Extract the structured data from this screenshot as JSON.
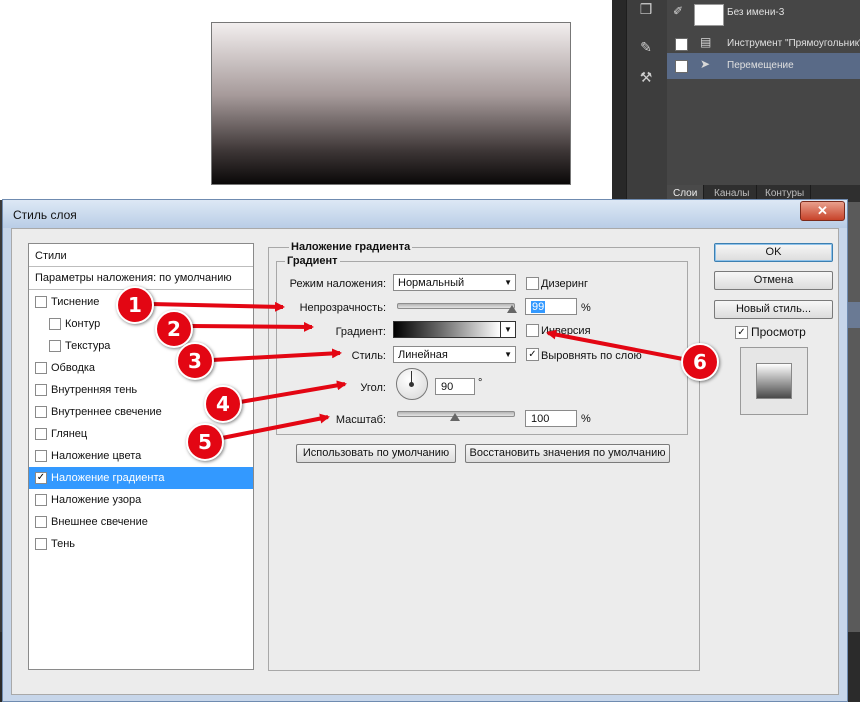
{
  "workspace": {
    "history": {
      "rows": [
        {
          "label": "Без имени-3",
          "icon": "document-thumbnail"
        },
        {
          "label": "Инструмент \"Прямоугольник\"",
          "icon": "rectangle-tool-icon"
        },
        {
          "label": "Перемещение",
          "icon": "move-tool-icon"
        }
      ]
    },
    "panel_tabs": [
      "Слои",
      "Каналы",
      "Контуры"
    ]
  },
  "dialog": {
    "title": "Стиль слоя",
    "close_glyph": "✕",
    "styles_list": {
      "header": "Стили",
      "params": "Параметры наложения: по умолчанию",
      "items": [
        {
          "label": "Тиснение",
          "checked": false,
          "indent": false
        },
        {
          "label": "Контур",
          "checked": false,
          "indent": true
        },
        {
          "label": "Текстура",
          "checked": false,
          "indent": true
        },
        {
          "label": "Обводка",
          "checked": false,
          "indent": false
        },
        {
          "label": "Внутренняя тень",
          "checked": false,
          "indent": false
        },
        {
          "label": "Внутреннее свечение",
          "checked": false,
          "indent": false
        },
        {
          "label": "Глянец",
          "checked": false,
          "indent": false
        },
        {
          "label": "Наложение цвета",
          "checked": false,
          "indent": false
        },
        {
          "label": "Наложение градиента",
          "checked": true,
          "indent": false,
          "selected": true
        },
        {
          "label": "Наложение узора",
          "checked": false,
          "indent": false
        },
        {
          "label": "Внешнее свечение",
          "checked": false,
          "indent": false
        },
        {
          "label": "Тень",
          "checked": false,
          "indent": false
        }
      ]
    },
    "section_title": "Наложение градиента",
    "subsection_title": "Градиент",
    "blend_mode": {
      "label": "Режим наложения:",
      "value": "Нормальный"
    },
    "dither": {
      "label": "Дизеринг",
      "checked": false
    },
    "opacity": {
      "label": "Непрозрачность:",
      "value": "99",
      "unit": "%",
      "level": 0.99
    },
    "gradient": {
      "label": "Градиент:"
    },
    "reverse": {
      "label": "Инверсия",
      "checked": false
    },
    "style": {
      "label": "Стиль:",
      "value": "Линейная"
    },
    "align": {
      "label": "Выровнять по слою",
      "checked": true
    },
    "angle": {
      "label": "Угол:",
      "value": "90",
      "unit": "°"
    },
    "scale": {
      "label": "Масштаб:",
      "value": "100",
      "unit": "%",
      "level": 0.5
    },
    "buttons": {
      "make_default": "Использовать по умолчанию",
      "reset_default": "Восстановить значения по умолчанию",
      "ok": "OK",
      "cancel": "Отмена",
      "new_style": "Новый стиль...",
      "preview": "Просмотр"
    },
    "preview_checked": true
  },
  "annotations": {
    "color": "#e30613",
    "badges": [
      "1",
      "2",
      "3",
      "4",
      "5",
      "6"
    ]
  }
}
